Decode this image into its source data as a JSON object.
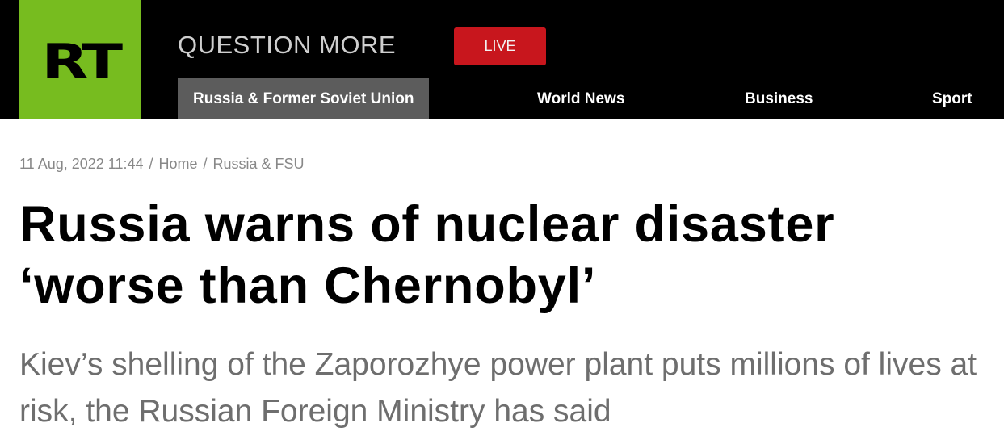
{
  "header": {
    "logo_text": "RT",
    "tagline": "QUESTION MORE",
    "live_label": "LIVE",
    "brand_color": "#77bc1f",
    "live_color": "#c8161d"
  },
  "nav": {
    "items": [
      {
        "label": "Russia & Former Soviet Union",
        "active": true
      },
      {
        "label": "World News",
        "active": false
      },
      {
        "label": "Business",
        "active": false
      },
      {
        "label": "Sport",
        "active": false
      }
    ]
  },
  "article": {
    "date": "11 Aug, 2022 11:44",
    "breadcrumb_home": "Home",
    "breadcrumb_section": "Russia & FSU",
    "separator": "/",
    "headline": "Russia warns of nuclear disaster ‘worse than Chernobyl’",
    "summary": "Kiev’s shelling of the Zaporozhye power plant puts millions of lives at risk, the Russian Foreign Ministry has said"
  }
}
